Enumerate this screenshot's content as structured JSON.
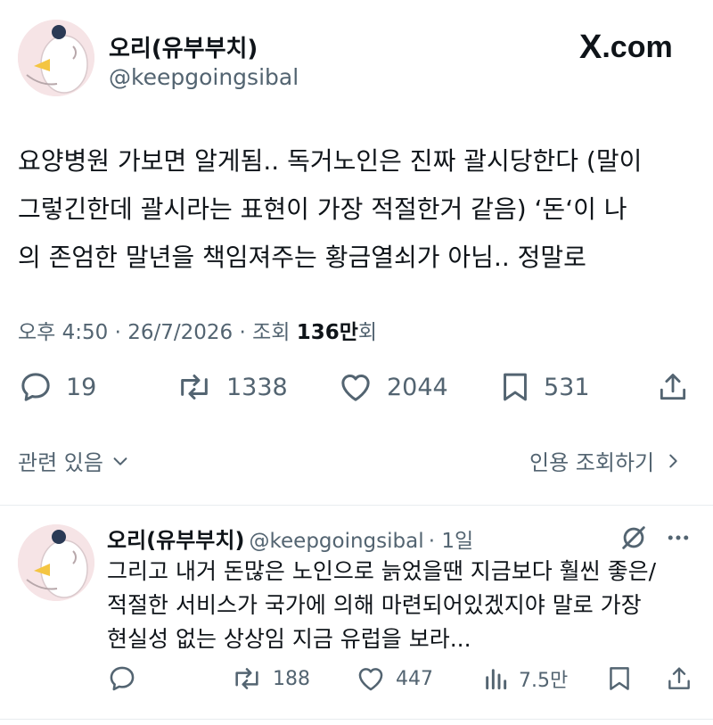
{
  "header": {
    "display_name": "오리(유부부치)",
    "handle": "@keepgoingsibal",
    "brand_x": "X",
    "brand_domain": ".com"
  },
  "tweet": {
    "lines": [
      "요양병원 가보면 알게됨.. 독거노인은 진짜 괄시당한다 (말이",
      "그렇긴한데 괄시라는 표현이 가장 적절한거 같음) ‘돈‘이 나",
      "의 존엄한 말년을 책임져주는 황금열쇠가 아님.. 정말로"
    ],
    "time": "오후 4:50",
    "dot": "·",
    "date": "26/7/2026",
    "views_prefix": "조회",
    "views_count": "136만",
    "views_suffix": "회"
  },
  "actions": {
    "replies": "19",
    "retweets": "1338",
    "likes": "2044",
    "bookmarks": "531"
  },
  "related": {
    "left_label": "관련 있음",
    "right_label": "인용 조회하기"
  },
  "reply": {
    "display_name": "오리(유부부치)",
    "handle": "@keepgoingsibal",
    "age": "· 1일",
    "lines": [
      "그리고 내거 돈많은 노인으로 늙었을땐 지금보다 훨씬 좋은/",
      "적절한 서비스가 국가에 의해 마련되어있겠지야 말로 가장",
      "현실성 없는 상상임 지금 유럽을 보라..."
    ],
    "retweets": "188",
    "likes": "447",
    "views": "7.5만"
  }
}
